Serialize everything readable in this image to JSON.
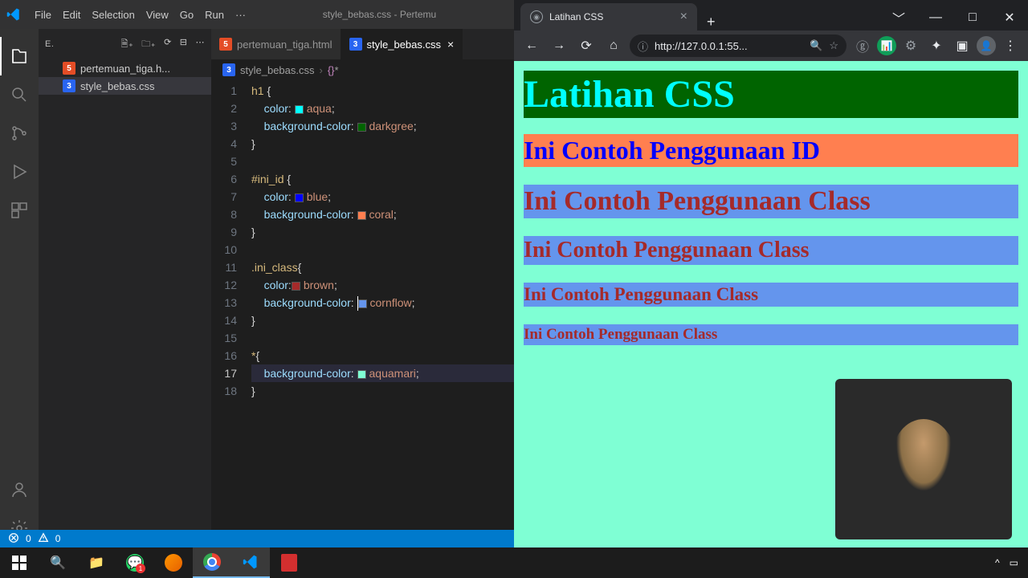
{
  "vscode": {
    "title": "style_bebas.css - Pertemu",
    "menu": [
      "File",
      "Edit",
      "Selection",
      "View",
      "Go",
      "Run",
      "···"
    ],
    "explorer_label": "E.",
    "files": [
      {
        "name": "pertemuan_tiga.h...",
        "type": "html"
      },
      {
        "name": "style_bebas.css",
        "type": "css"
      }
    ],
    "tabs": [
      {
        "name": "pertemuan_tiga.html",
        "type": "html",
        "active": false
      },
      {
        "name": "style_bebas.css",
        "type": "css",
        "active": true
      }
    ],
    "breadcrumb": {
      "file": "style_bebas.css",
      "symbol": "*"
    },
    "code_lines": [
      {
        "n": 1,
        "sel": "h1 ",
        "punct": "{"
      },
      {
        "n": 2,
        "prop": "color",
        "swatch": "#00ffff",
        "val": "aqua"
      },
      {
        "n": 3,
        "prop": "background-color",
        "swatch": "#006400",
        "val": "darkgree"
      },
      {
        "n": 4,
        "punct_only": "}"
      },
      {
        "n": 5,
        "blank": true
      },
      {
        "n": 6,
        "sel": "#ini_id ",
        "punct": "{"
      },
      {
        "n": 7,
        "prop": "color",
        "swatch": "#0000ff",
        "val": "blue"
      },
      {
        "n": 8,
        "prop": "background-color",
        "swatch": "#ff7f50",
        "val": "coral"
      },
      {
        "n": 9,
        "punct_only": "}"
      },
      {
        "n": 10,
        "blank": true
      },
      {
        "n": 11,
        "sel": ".ini_class",
        "punct": "{"
      },
      {
        "n": 12,
        "prop": "color",
        "swatch": "#a52a2a",
        "val": "brown",
        "nosep": true
      },
      {
        "n": 13,
        "prop": "background-color",
        "swatch": "#6495ed",
        "val": "cornflow",
        "cursor_before_swatch": true
      },
      {
        "n": 14,
        "punct_only": "}"
      },
      {
        "n": 15,
        "blank": true
      },
      {
        "n": 16,
        "sel": "*",
        "punct": "{"
      },
      {
        "n": 17,
        "prop": "background-color",
        "swatch": "#7fffd4",
        "val": "aquamari",
        "active": true
      },
      {
        "n": 18,
        "punct_only": "}"
      }
    ],
    "status": {
      "errors": "0",
      "warnings": "0"
    }
  },
  "chrome": {
    "tab_title": "Latihan CSS",
    "url": "http://127.0.0.1:55..."
  },
  "page": {
    "h1": "Latihan CSS",
    "id_text": "Ini Contoh Penggunaan ID",
    "class_text": "Ini Contoh Penggunaan Class",
    "colors": {
      "body_bg": "#7fffd4",
      "h1_color": "#00ffff",
      "h1_bg": "#006400",
      "id_color": "#0000ff",
      "id_bg": "#ff7f50",
      "class_color": "#a52a2a",
      "class_bg": "#6495ed"
    }
  }
}
